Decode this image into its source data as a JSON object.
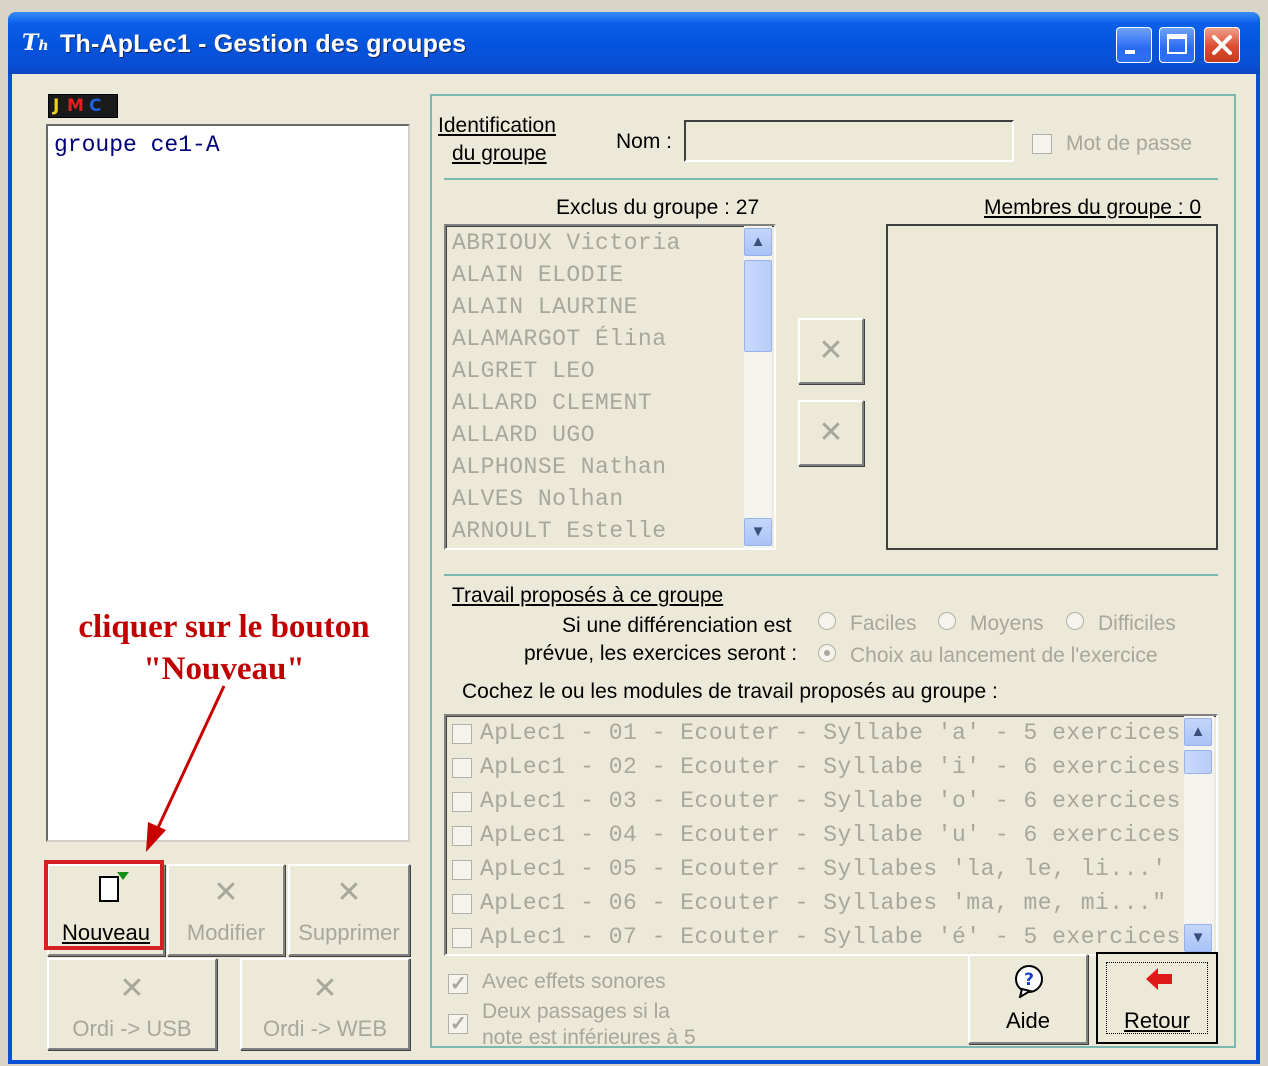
{
  "window": {
    "title": "Th-ApLec1  - Gestion des groupes"
  },
  "logo": {
    "letters": [
      "J",
      "M",
      "C"
    ]
  },
  "groups": {
    "items": [
      "groupe ce1-A"
    ]
  },
  "annotation": {
    "line1": "cliquer sur le bouton",
    "line2": "\"Nouveau\""
  },
  "buttons": {
    "new": "Nouveau",
    "modify": "Modifier",
    "delete": "Supprimer",
    "usb": "Ordi -> USB",
    "web": "Ordi -> WEB",
    "help": "Aide",
    "back": "Retour"
  },
  "identification": {
    "label_line1": "Identification",
    "label_line2": "du groupe",
    "name_label": "Nom :",
    "name_value": "",
    "password_label": "Mot de passe"
  },
  "excluded": {
    "title": "Exclus du groupe : 27",
    "students": [
      "ABRIOUX Victoria",
      "ALAIN ELODIE",
      "ALAIN LAURINE",
      "ALAMARGOT Élina",
      "ALGRET LEO",
      "ALLARD CLEMENT",
      "ALLARD UGO",
      "ALPHONSE Nathan",
      "ALVES Nolhan",
      "ARNOULT Estelle"
    ]
  },
  "members": {
    "title": "Membres du groupe : 0",
    "students": []
  },
  "work": {
    "title": "Travail proposés à ce groupe",
    "diff_line1": "Si une différenciation est",
    "diff_line2": "prévue, les exercices seront :",
    "options": [
      "Faciles",
      "Moyens",
      "Difficiles",
      "Choix au lancement de l'exercice"
    ],
    "modules_prompt": "Cochez le ou les modules de travail proposés au groupe :",
    "modules": [
      "ApLec1 - 01 - Ecouter - Syllabe 'a' - 5 exercices",
      "ApLec1 - 02 - Ecouter - Syllabe 'i' - 6 exercices",
      "ApLec1 - 03 - Ecouter - Syllabe 'o' - 6 exercices",
      "ApLec1 - 04 - Ecouter - Syllabe 'u' - 6 exercices",
      "ApLec1 - 05 - Ecouter - Syllabes 'la, le, li...' -",
      "ApLec1 - 06 - Ecouter - Syllabes 'ma, me, mi...\" -",
      "ApLec1 - 07 - Ecouter - Syllabe 'é' - 5 exercices"
    ]
  },
  "options": {
    "sound_effects": "Avec effets sonores",
    "two_passes_line1": "Deux passages si la",
    "two_passes_line2": "note est inférieures à 5"
  },
  "colors": {
    "titlebar": "#0553dc",
    "face": "#ece9d8",
    "disabled_text": "#a9a69a",
    "annotation": "#c00000",
    "highlight": "#d42020",
    "frame": "#7ab8b0"
  }
}
